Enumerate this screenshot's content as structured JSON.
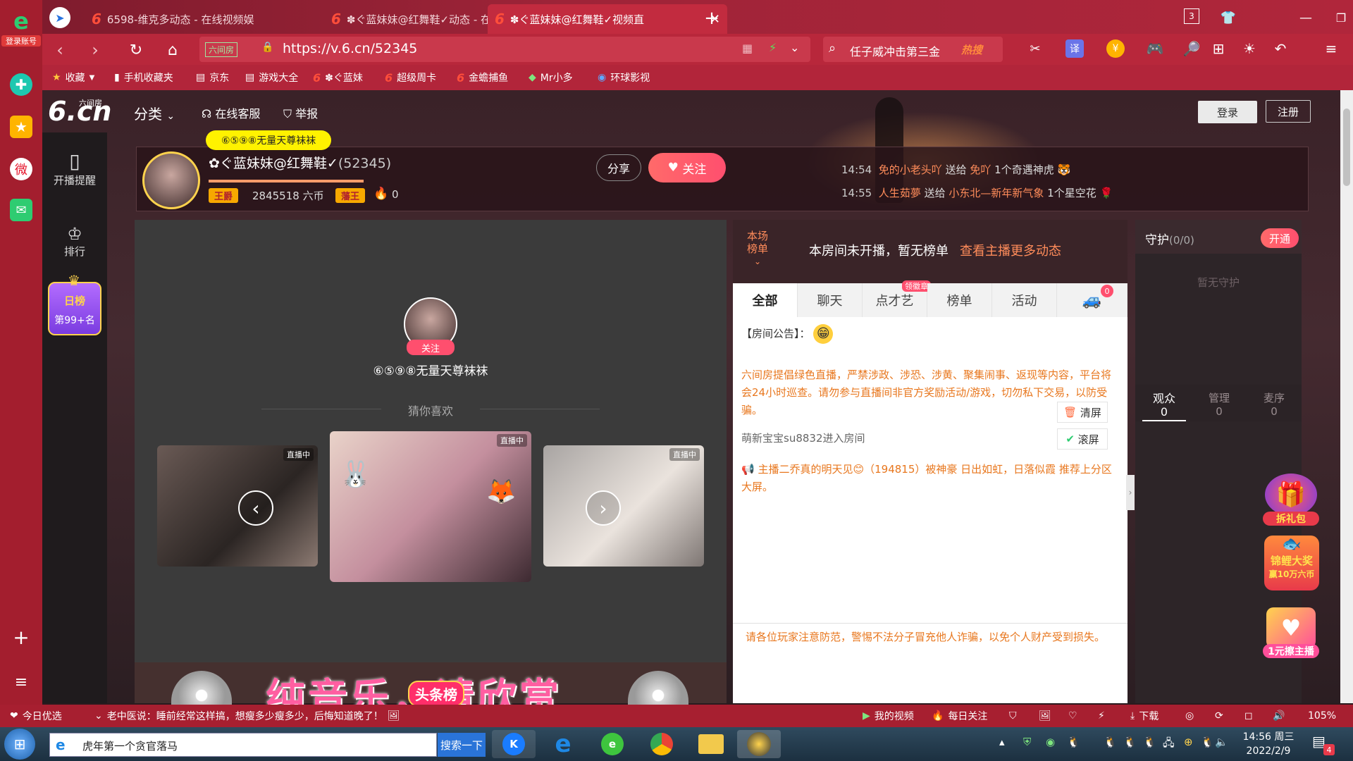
{
  "browser": {
    "login_account_label": "登录账号",
    "tabs": [
      {
        "title": "6598-维克多动态 - 在线视频娱"
      },
      {
        "title": "✽ぐ蓝妹妹@红舞鞋✓动态 - 在"
      },
      {
        "title": "✽ぐ蓝妹妹@红舞鞋✓视频直"
      }
    ],
    "new_tab_label": "+",
    "tab_count": "3",
    "url": "https://v.6.cn/52345",
    "url_site_badge": "六间房",
    "search_text": "任子威冲击第三金",
    "search_hot_label": "热搜",
    "bookmarks": [
      {
        "label": "收藏"
      },
      {
        "label": "手机收藏夹"
      },
      {
        "label": "京东"
      },
      {
        "label": "游戏大全"
      },
      {
        "label": "✽ぐ蓝妹"
      },
      {
        "label": "超级周卡"
      },
      {
        "label": "金蟾捕鱼"
      },
      {
        "label": "Mr小多"
      },
      {
        "label": "环球影视"
      }
    ]
  },
  "site": {
    "logo_main": "6.cn",
    "logo_sub": "六间房",
    "nav_category": "分类",
    "nav_service": "在线客服",
    "nav_report": "举报",
    "login": "登录",
    "register": "注册"
  },
  "sidenav": {
    "items": [
      {
        "label": "开播提醒"
      },
      {
        "label": "排行"
      }
    ],
    "rank_badge_title": "日榜",
    "rank_badge_value": "第99+名"
  },
  "anchor": {
    "top_fan_badge": "⑥⑤⑨⑧无量天尊袜袜",
    "name": "✿ぐ蓝妹妹@红舞鞋✓",
    "room_id": "(52345)",
    "rank_label": "王爵",
    "coins": "2845518 六币",
    "badge2": "藩王",
    "heat": "0",
    "share": "分享",
    "follow": "关注"
  },
  "gift_feed": [
    {
      "time": "14:54",
      "sender": "免的小老头吖",
      "action": "送给",
      "receiver": "免吖",
      "gift": "1个奇遇神虎"
    },
    {
      "time": "14:55",
      "sender": "人生茹夢",
      "action": "送给",
      "receiver": "小东北—新年新气象",
      "gift": "1个星空花"
    }
  ],
  "player": {
    "follow_label": "关注",
    "guest_name": "⑥⑤⑨⑧无量天尊袜袜",
    "recommend_title": "猜你喜欢",
    "live_tag": "直播中",
    "banner_text": "纯音乐，请欣赏",
    "banner_badge": "头条榜"
  },
  "chat": {
    "rank_label_line1": "本场",
    "rank_label_line2": "榜单",
    "rank_notice": "本房间未开播，暂无榜单",
    "rank_link": "查看主播更多动态",
    "tabs": [
      {
        "label": "全部"
      },
      {
        "label": "聊天"
      },
      {
        "label": "点才艺"
      },
      {
        "label": "榜单"
      },
      {
        "label": "活动"
      }
    ],
    "talent_badge": "领徽章",
    "car_count": "0",
    "announcement_label": "【房间公告】：",
    "policy_text": "六间房提倡绿色直播，严禁涉政、涉恐、涉黄、聚集闹事、返现等内容，平台将会24小时巡查。请勿参与直播间非官方奖励活动/游戏，切勿私下交易，以防受骗。",
    "enter_msg": "萌新宝宝su8832进入房间",
    "clear_screen": "清屏",
    "scroll_screen": "滚屏",
    "system_msg": "主播二乔真的明天见😊（194815）被神豪 日出如虹，日落似霞 推荐上分区大屏。",
    "bottom_warning": "请各位玩家注意防范，警惕不法分子冒充他人诈骗，以免个人财产受到损失。"
  },
  "guard": {
    "title": "守护",
    "count": "(0/0)",
    "open": "开通",
    "empty": "暂无守护",
    "tabs": [
      {
        "label": "观众",
        "count": "0"
      },
      {
        "label": "管理",
        "count": "0"
      },
      {
        "label": "麦序",
        "count": "0"
      }
    ],
    "promo_gift": "拆礼包",
    "promo_koi_line1": "锦鲤大奖",
    "promo_koi_line2": "赢10万六币",
    "promo_grab": "1元擦主播"
  },
  "statusbar": {
    "today_label": "今日优选",
    "news": "老中医说：睡前经常这样搞，想瘦多少瘦多少，后悔知道晚了！",
    "my_video": "我的视频",
    "daily_follow": "每日关注",
    "download": "下载",
    "zoom": "105%"
  },
  "taskbar": {
    "search_placeholder": "虎年第一个贪官落马",
    "search_button": "搜索一下",
    "time": "14:56 周三",
    "date": "2022/2/9",
    "notif_count": "4"
  },
  "colors": {
    "browser_red": "#b8273b",
    "accent_orange": "#e8771e",
    "follow_pink": "#ff4f6e"
  }
}
